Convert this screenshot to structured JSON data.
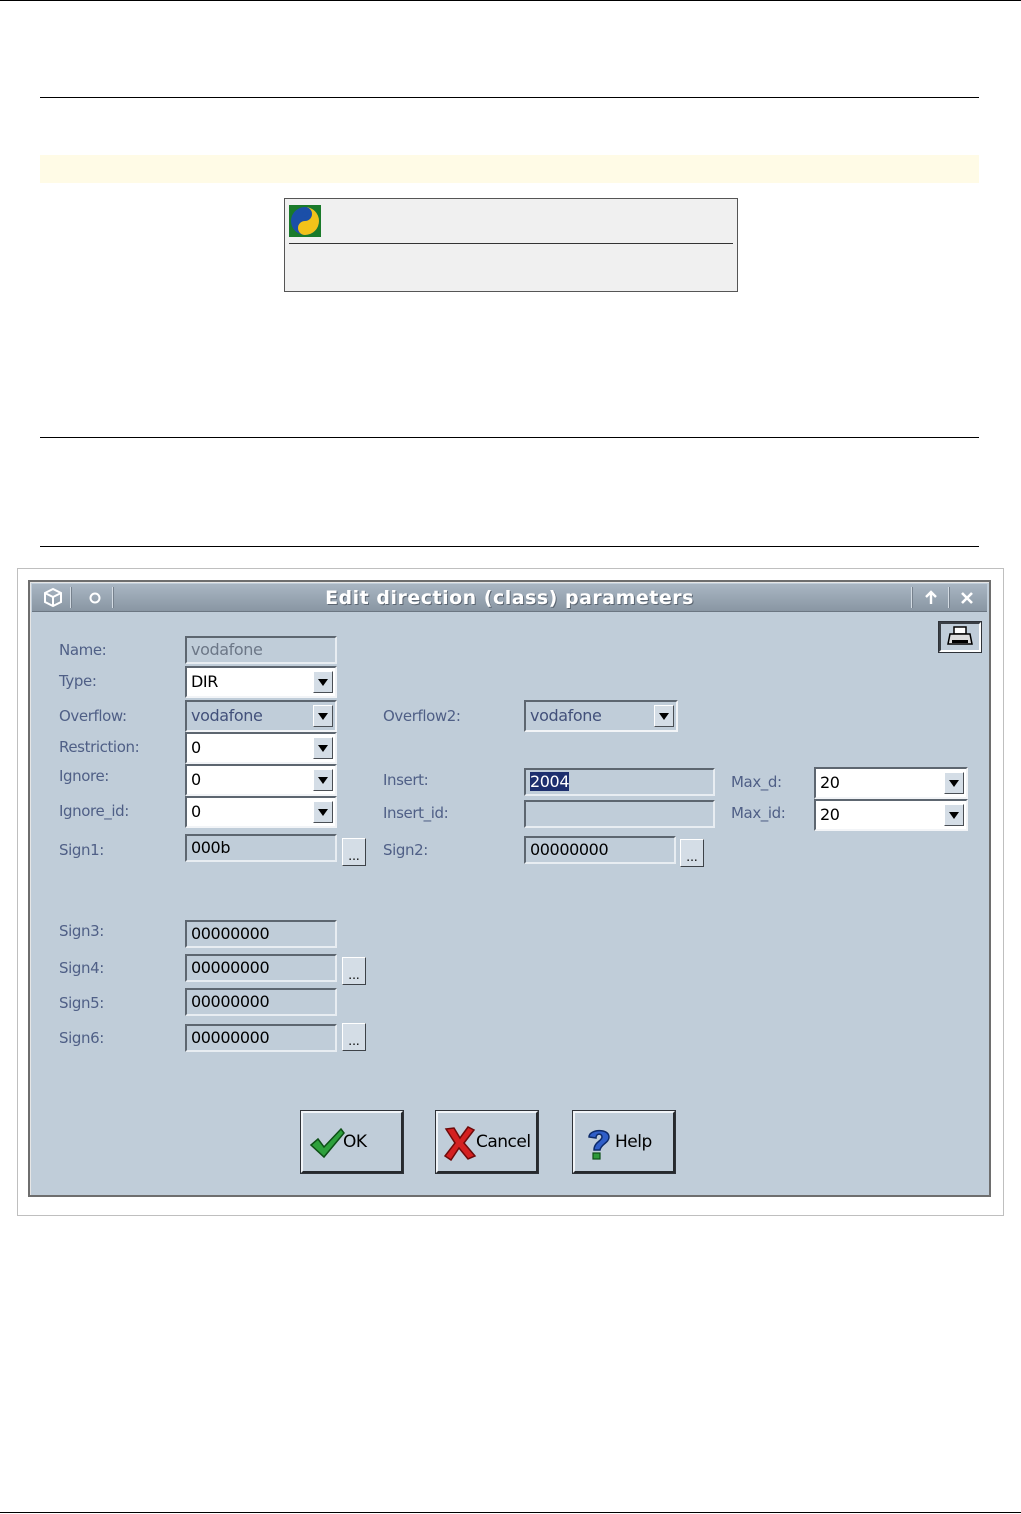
{
  "dialog": {
    "title": "Edit direction (class) parameters",
    "fields": {
      "name": {
        "label": "Name:",
        "value": "vodafone"
      },
      "type": {
        "label": "Type:",
        "value": "DIR"
      },
      "overflow": {
        "label": "Overflow:",
        "value": "vodafone"
      },
      "overflow2": {
        "label": "Overflow2:",
        "value": "vodafone"
      },
      "restriction": {
        "label": "Restriction:",
        "value": "0"
      },
      "ignore": {
        "label": "Ignore:",
        "value": "0"
      },
      "insert": {
        "label": "Insert:",
        "value": "2004"
      },
      "max_d": {
        "label": "Max_d:",
        "value": "20"
      },
      "ignore_id": {
        "label": "Ignore_id:",
        "value": "0"
      },
      "insert_id": {
        "label": "Insert_id:",
        "value": ""
      },
      "max_id": {
        "label": "Max_id:",
        "value": "20"
      },
      "sign1": {
        "label": "Sign1:",
        "value": "000b"
      },
      "sign2": {
        "label": "Sign2:",
        "value": "00000000"
      },
      "sign3": {
        "label": "Sign3:",
        "value": "00000000"
      },
      "sign4": {
        "label": "Sign4:",
        "value": "00000000"
      },
      "sign5": {
        "label": "Sign5:",
        "value": "00000000"
      },
      "sign6": {
        "label": "Sign6:",
        "value": "00000000"
      }
    },
    "browse_label": "...",
    "buttons": {
      "ok": "OK",
      "cancel": "Cancel",
      "help": "Help"
    },
    "titlebar_icons": [
      "window-cube-icon",
      "pin-icon",
      "maximize-arrow-icon",
      "close-icon"
    ]
  },
  "colors": {
    "window_bg": "#c0cdd9",
    "label": "#4f5f86",
    "titlebar": "#9aa7b4",
    "note_bar": "#fffbe6"
  }
}
